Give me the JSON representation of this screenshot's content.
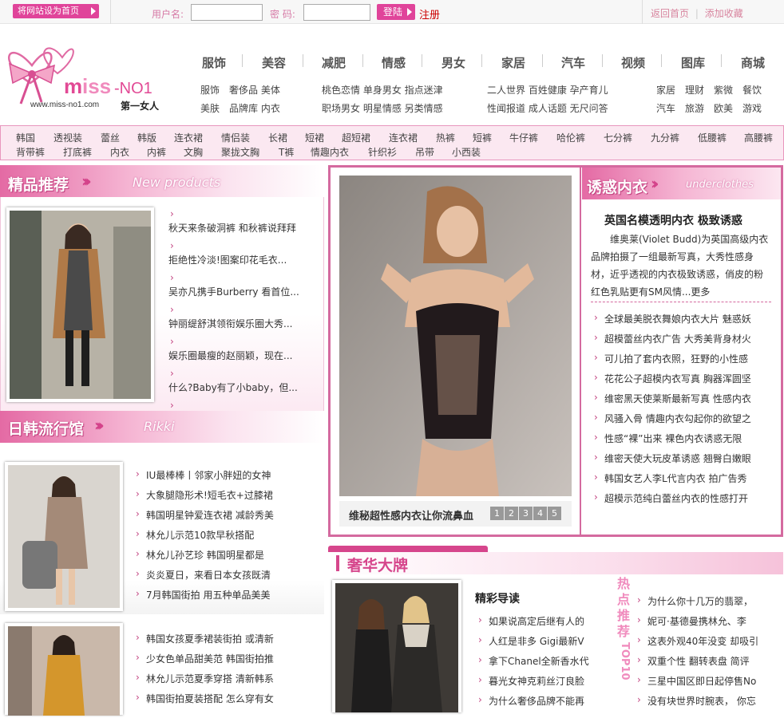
{
  "topbar": {
    "set_home": "将网站设为首页",
    "username_label": "用户名:",
    "password_label": "密 码:",
    "login": "登陆",
    "register": "注册",
    "home_link": "返回首页",
    "sep": "|",
    "favorite_link": "添加收藏"
  },
  "logo": {
    "brand": "MiSS-NO1",
    "url": "www.miss-no1.com",
    "tagline": "第一女人"
  },
  "nav": {
    "main": [
      "服饰",
      "美容",
      "减肥",
      "情感",
      "男女",
      "家居",
      "汽车",
      "视频",
      "图库",
      "商城"
    ],
    "sub": [
      {
        "row1": "服饰　奢侈品 美体",
        "row2": "美肤　品牌库 内衣"
      },
      {
        "row1": "桃色恋情 单身男女 指点迷津",
        "row2": "职场男女 明星情感 另类情感"
      },
      {
        "row1": "二人世界 百姓健康 孕产育儿",
        "row2": "性闻报道 成人话题 无尺问答"
      },
      {
        "row1": "家居　理财　紫微　餐饮",
        "row2": "汽车　旅游　欧美　游戏"
      }
    ]
  },
  "keywords": {
    "row1": [
      "韩国",
      "透视装",
      "蕾丝",
      "韩版",
      "连衣裙",
      "情侣装",
      "长裙",
      "短裙",
      "超短裙",
      "连衣裙",
      "热裤",
      "短裤",
      "牛仔裤",
      "哈伦裤",
      "七分裤",
      "九分裤",
      "低腰裤",
      "高腰裤"
    ],
    "row2": [
      "背带裤",
      "打底裤",
      "内衣",
      "内裤",
      "文胸",
      "聚拢文胸",
      "T裤",
      "情趣内衣",
      "针织衫",
      "吊带",
      "小西装"
    ]
  },
  "featured": {
    "title": "精品推荐",
    "subtitle": "New products",
    "items": [
      "秋天来条破洞裤 和秋裤说拜拜",
      "拒绝性冷淡!图案印花毛衣...",
      "吴亦凡携手Burberry 看首位...",
      "钟丽缇舒淇领衔娱乐圈大秀...",
      "娱乐圈最瘦的赵丽颖，现在...",
      "什么?Baby有了小baby，但..."
    ]
  },
  "korean": {
    "title": "日韩流行馆",
    "subtitle": "Rikki",
    "block1": [
      "IU最棒棒丨邻家小胖妞的女神",
      "大象腿隐形术!短毛衣+过膝裙",
      "韩国明星钟爱连衣裙 减龄秀美",
      "林允儿示范10款早秋搭配",
      "林允儿孙艺珍 韩国明星都是",
      "炎炎夏日，来看日本女孩既清",
      "7月韩国街拍 用五种单品美美"
    ],
    "block2": [
      "韩国女孩夏季裙装街拍 或清新",
      "少女色单品甜美范 韩国街拍推",
      "林允儿示范夏季穿搭 清新韩系",
      "韩国街拍夏装搭配 怎么穿有女"
    ]
  },
  "slideshow": {
    "caption": "维秘超性感内衣让你流鼻血",
    "pages": [
      "1",
      "2",
      "3",
      "4",
      "5"
    ]
  },
  "lingerie": {
    "title": "诱惑内衣",
    "subtitle": "underclothes",
    "headline": "英国名模透明内衣 极致诱惑",
    "summary": "维奥莱(Violet Budd)为英国高级内衣品牌拍摄了一组最新写真，大秀性感身材，近乎透视的内衣极致诱惑，俏皮的粉红色乳贴更有SM风情...更多",
    "items": [
      "全球最美脱衣舞娘内衣大片 魅惑妖",
      "超模蕾丝内衣广告 大秀美背身材火",
      "可儿拍了套内衣照，狂野的小性感",
      "花花公子超模内衣写真 胸器浑圆坚",
      "维密黑天使莱斯最新写真 性感内衣",
      "风骚入骨 情趣内衣勾起你的欲望之",
      "性感“裸”出来 裸色内衣诱惑无限",
      "维密天使大玩皮革诱惑 翘臀白嫩眼",
      "韩国女艺人李L代言内衣 拍广告秀",
      "超模示范纯白蕾丝内衣的性感打开"
    ]
  },
  "luxury": {
    "title": "奢华大牌",
    "guide_title": "精彩导读",
    "guide": [
      "如果说高定后继有人的",
      "人红是非多 Gigi最新V",
      "拿下Chanel全新香水代",
      "暮光女神克莉丝汀良脸",
      "为什么奢侈品牌不能再"
    ],
    "hot_label": "热点推荐",
    "top10": "TOP10",
    "hot": [
      "为什么你十几万的翡翠，",
      "妮可·基德曼携林允、李",
      "这表外观40年没变 却吸引",
      "双重个性 翻转表盘 简评",
      "三星中国区即日起停售No",
      "没有块世界时腕表， 你忘"
    ]
  },
  "colors": {
    "accent": "#e0449a",
    "pink_border": "#d46a9f",
    "bg_pink": "#fbe8f1"
  }
}
